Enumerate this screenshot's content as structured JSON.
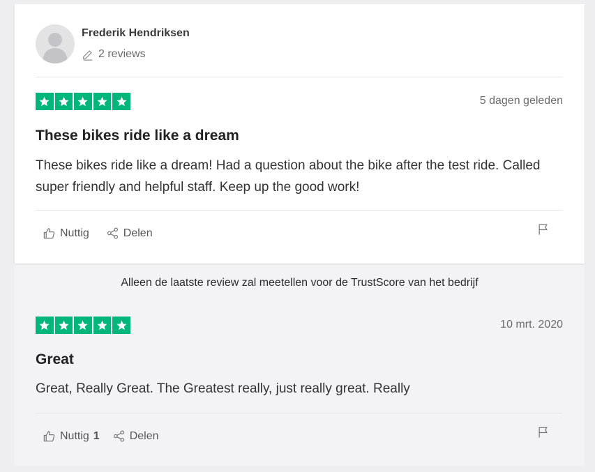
{
  "reviewer": {
    "name": "Frederik Hendriksen",
    "reviews_label": "2 reviews",
    "icons": {
      "avatar": "user-avatar",
      "reviews": "pencil-icon"
    }
  },
  "reviews": [
    {
      "rating": 5,
      "date": "5 dagen geleden",
      "title": "These bikes ride like a dream",
      "body": "These bikes ride like a dream! Had a question about the bike after the test ride. Called super friendly and helpful staff. Keep up the good work!",
      "useful_label": "Nuttig",
      "useful_count": "",
      "share_label": "Delen"
    },
    {
      "rating": 5,
      "date": "10 mrt. 2020",
      "title": "Great",
      "body": "Great, Really Great. The Greatest really, just really great. Really",
      "useful_label": "Nuttig",
      "useful_count": "1",
      "share_label": "Delen"
    }
  ],
  "trustscore_note": "Alleen de laatste review zal meetellen voor de TrustScore van het bedrijf",
  "colors": {
    "star_green": "#00b67a",
    "card_bg": "#ffffff",
    "section_bg": "#f3f3f6"
  },
  "icons": [
    "thumbs-up-icon",
    "share-icon",
    "flag-icon",
    "star-icon"
  ]
}
